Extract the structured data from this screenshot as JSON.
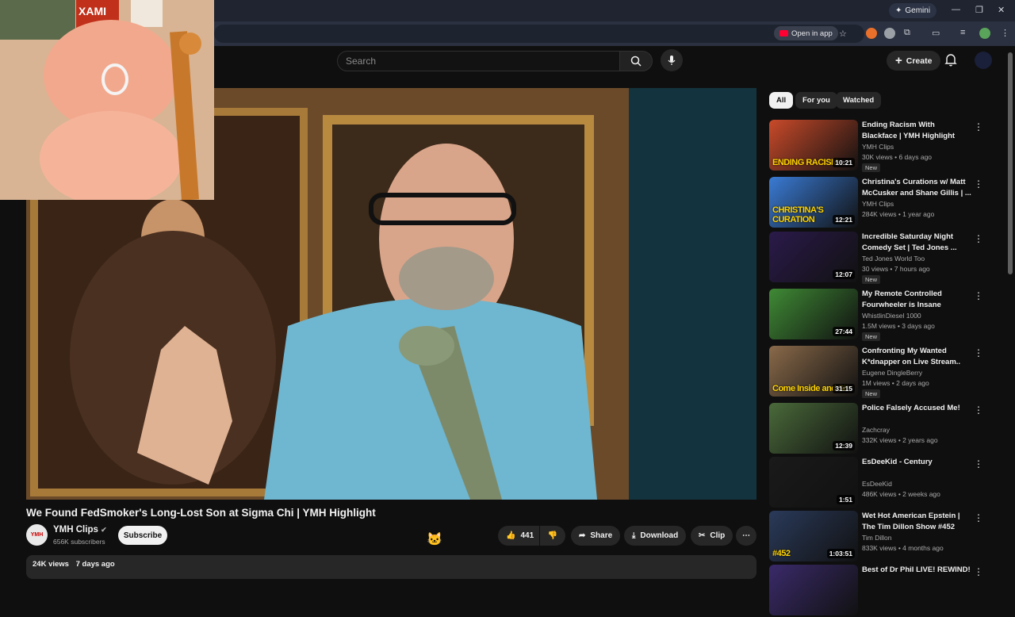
{
  "browser": {
    "gemini_label": "Gemini",
    "open_in_app_label": "Open in app"
  },
  "header": {
    "search_placeholder": "Search",
    "create_label": "Create"
  },
  "pip": {
    "poster_text": "XAMI"
  },
  "video": {
    "title": "We Found FedSmoker's Long-Lost Son at Sigma Chi | YMH Highlight",
    "channel_name": "YMH Clips",
    "channel_avatar_text": "YMH",
    "subscribers": "656K subscribers",
    "subscribe_label": "Subscribe",
    "likes": "441",
    "share_label": "Share",
    "download_label": "Download",
    "clip_label": "Clip",
    "views": "24K views",
    "date": "7 days ago"
  },
  "chips": [
    {
      "label": "All",
      "active": true
    },
    {
      "label": "For you",
      "active": false
    },
    {
      "label": "Watched",
      "active": false
    }
  ],
  "recommendations": [
    {
      "title": "Ending Racism With Blackface | YMH Highlight",
      "channel": "YMH Clips",
      "meta": "30K views • 6 days ago",
      "badge": "New",
      "duration": "10:21",
      "thumb_text": "ENDING RACISM",
      "color": "#c94a2a"
    },
    {
      "title": "Christina's Curations w/ Matt McCusker and Shane Gillis | ...",
      "channel": "YMH Clips",
      "meta": "284K views • 1 year ago",
      "badge": "",
      "duration": "12:21",
      "thumb_text": "CHRISTINA'S CURATION",
      "color": "#3a7bd5"
    },
    {
      "title": "Incredible Saturday Night Comedy Set | Ted Jones ...",
      "channel": "Ted Jones World Too",
      "meta": "30 views • 7 hours ago",
      "badge": "New",
      "duration": "12:07",
      "thumb_text": "",
      "color": "#2a1a4a"
    },
    {
      "title": "My Remote Controlled Fourwheeler is Insane",
      "channel": "WhistlinDiesel 1000",
      "meta": "1.5M views • 3 days ago",
      "badge": "New",
      "duration": "27:44",
      "thumb_text": "",
      "color": "#3f8a35"
    },
    {
      "title": "Confronting My Wanted K*dnapper on Live Stream..",
      "channel": "Eugene DingleBerry",
      "meta": "1M views • 2 days ago",
      "badge": "New",
      "duration": "31:15",
      "thumb_text": "Come Inside and Sit",
      "color": "#8a6a4a"
    },
    {
      "title": "Police Falsely Accused Me!",
      "channel": "Zachcray",
      "meta": "332K views • 2 years ago",
      "badge": "",
      "duration": "12:39",
      "thumb_text": "",
      "color": "#4a6a3a"
    },
    {
      "title": "EsDeeKid - Century",
      "channel": "EsDeeKid",
      "meta": "486K views • 2 weeks ago",
      "badge": "",
      "duration": "1:51",
      "thumb_text": "",
      "color": "#1a1a1a"
    },
    {
      "title": "Wet Hot American Epstein | The Tim Dillon Show #452",
      "channel": "Tim Dillon",
      "meta": "833K views • 4 months ago",
      "badge": "",
      "duration": "1:03:51",
      "thumb_text": "#452",
      "color": "#2a3a5a"
    },
    {
      "title": "Best of Dr Phil LIVE! REWIND!",
      "channel": "",
      "meta": "",
      "badge": "",
      "duration": "",
      "thumb_text": "",
      "color": "#3a2a6a"
    }
  ]
}
